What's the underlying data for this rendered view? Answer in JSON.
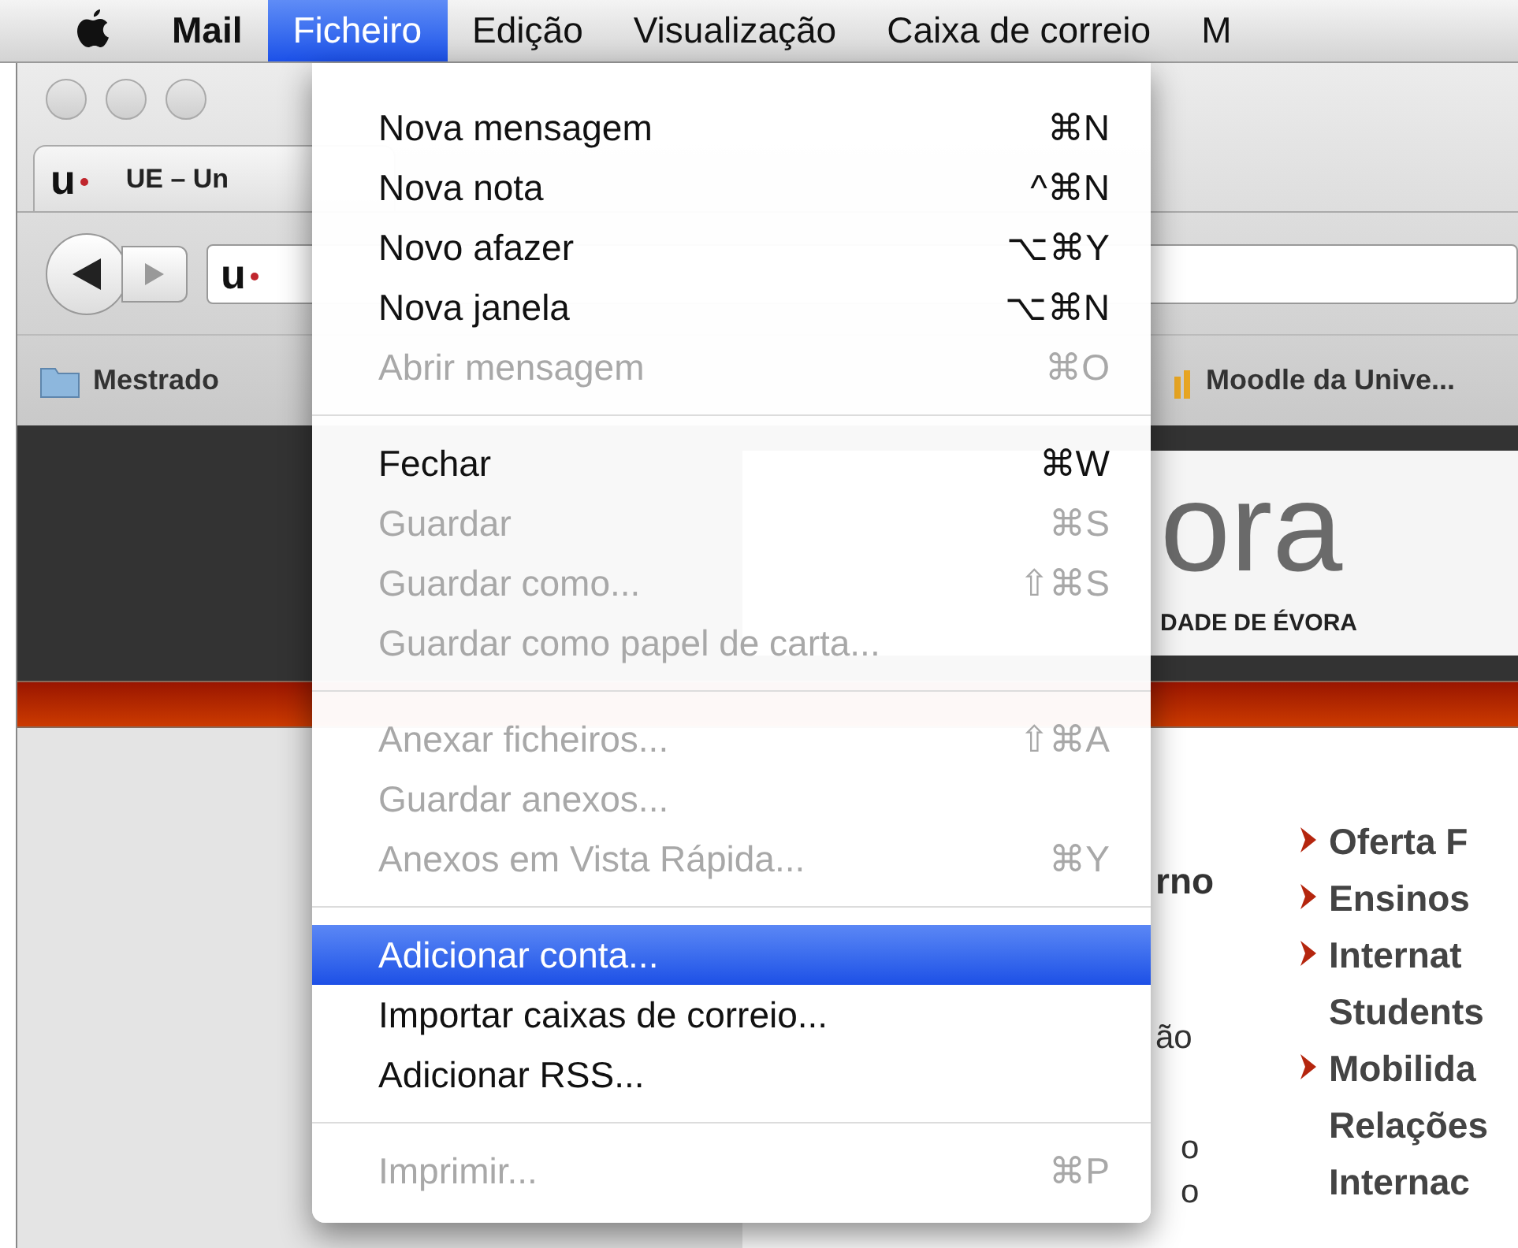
{
  "menu_bar": {
    "items": [
      {
        "label": "Mail",
        "selected": false,
        "kind": "app"
      },
      {
        "label": "Ficheiro",
        "selected": true,
        "kind": "menu"
      },
      {
        "label": "Edição",
        "selected": false,
        "kind": "menu"
      },
      {
        "label": "Visualização",
        "selected": false,
        "kind": "menu"
      },
      {
        "label": "Caixa de correio",
        "selected": false,
        "kind": "menu"
      },
      {
        "label": "M",
        "selected": false,
        "kind": "menu"
      }
    ]
  },
  "browser": {
    "tab": {
      "favicon": "u",
      "title": "UE – Un"
    },
    "address_bar": {
      "favicon": "u"
    },
    "bookmarks": [
      {
        "label": "Mestrado",
        "kind": "folder"
      },
      {
        "label": "Moodle da Unive...",
        "kind": "site"
      }
    ],
    "page": {
      "logo_text": "ora",
      "logo_subtitle": "DADE DE ÉVORA",
      "fragments": [
        {
          "text": "rno",
          "bold": true
        },
        {
          "text": "ão",
          "bold": false
        },
        {
          "text": "o",
          "bold": false
        },
        {
          "text": "o",
          "bold": false
        }
      ],
      "links": [
        {
          "lines": [
            "Oferta F"
          ]
        },
        {
          "lines": [
            "Ensinos"
          ]
        },
        {
          "lines": [
            "Internat",
            "Students"
          ]
        },
        {
          "lines": [
            "Mobilida",
            "Relações",
            "Internac"
          ]
        }
      ]
    }
  },
  "file_menu": {
    "items": [
      {
        "kind": "item",
        "label": "Nova mensagem",
        "shortcut": "⌘N",
        "disabled": false,
        "selected": false
      },
      {
        "kind": "item",
        "label": "Nova nota",
        "shortcut": "^⌘N",
        "disabled": false,
        "selected": false
      },
      {
        "kind": "item",
        "label": "Novo afazer",
        "shortcut": "⌥⌘Y",
        "disabled": false,
        "selected": false
      },
      {
        "kind": "item",
        "label": "Nova janela",
        "shortcut": "⌥⌘N",
        "disabled": false,
        "selected": false
      },
      {
        "kind": "item",
        "label": "Abrir mensagem",
        "shortcut": "⌘O",
        "disabled": true,
        "selected": false
      },
      {
        "kind": "separator"
      },
      {
        "kind": "item",
        "label": "Fechar",
        "shortcut": "⌘W",
        "disabled": false,
        "selected": false
      },
      {
        "kind": "item",
        "label": "Guardar",
        "shortcut": "⌘S",
        "disabled": true,
        "selected": false
      },
      {
        "kind": "item",
        "label": "Guardar como...",
        "shortcut": "⇧⌘S",
        "disabled": true,
        "selected": false
      },
      {
        "kind": "item",
        "label": "Guardar como papel de carta...",
        "disabled": true,
        "selected": false
      },
      {
        "kind": "separator"
      },
      {
        "kind": "item",
        "label": "Anexar ficheiros...",
        "shortcut": "⇧⌘A",
        "disabled": true,
        "selected": false
      },
      {
        "kind": "item",
        "label": "Guardar anexos...",
        "disabled": true,
        "selected": false
      },
      {
        "kind": "item",
        "label": "Anexos em Vista Rápida...",
        "shortcut": "⌘Y",
        "disabled": true,
        "selected": false
      },
      {
        "kind": "separator"
      },
      {
        "kind": "item",
        "label": "Adicionar conta...",
        "disabled": false,
        "selected": true
      },
      {
        "kind": "item",
        "label": "Importar caixas de correio...",
        "disabled": false,
        "selected": false
      },
      {
        "kind": "item",
        "label": "Adicionar RSS...",
        "disabled": false,
        "selected": false
      },
      {
        "kind": "separator"
      },
      {
        "kind": "item",
        "label": "Imprimir...",
        "shortcut": "⌘P",
        "disabled": true,
        "selected": false
      }
    ]
  }
}
